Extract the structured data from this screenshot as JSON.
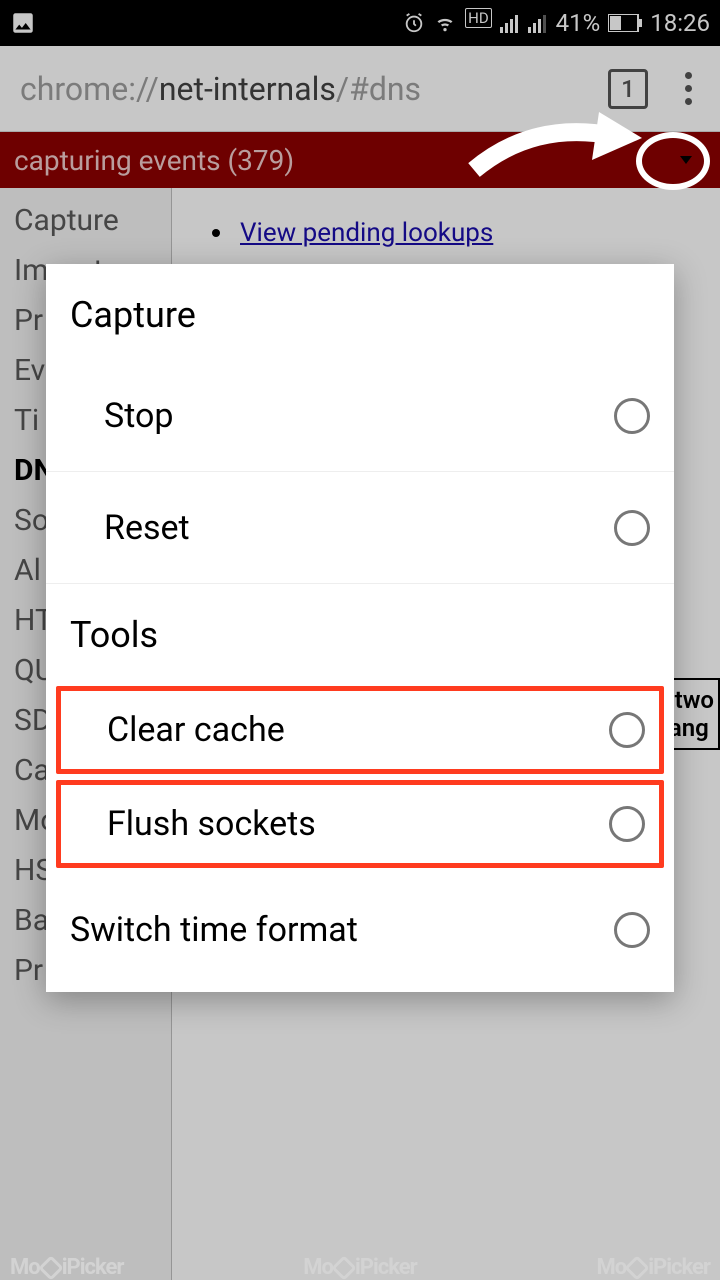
{
  "status": {
    "battery_pct": "41%",
    "time": "18:26",
    "hd": "HD"
  },
  "omnibox": {
    "url_pre": "chrome://",
    "url_bold": "net-internals",
    "url_post": "/#dns",
    "tab_count": "1"
  },
  "banner": {
    "text": "capturing events (379)"
  },
  "sidebar": {
    "items": [
      {
        "label": "Capture"
      },
      {
        "label": "Import"
      },
      {
        "label": "Pr"
      },
      {
        "label": "Ev"
      },
      {
        "label": "Ti"
      },
      {
        "label": "DN",
        "active": true
      },
      {
        "label": "So"
      },
      {
        "label": "Al"
      },
      {
        "label": "HT"
      },
      {
        "label": "QU"
      },
      {
        "label": "SD"
      },
      {
        "label": "Ca"
      },
      {
        "label": "Mo"
      },
      {
        "label": "HS"
      },
      {
        "label": "Ba"
      },
      {
        "label": "Pr"
      }
    ]
  },
  "main": {
    "pending_link": "View pending lookups",
    "peek_line1": "letwo",
    "peek_line2": "hang"
  },
  "dialog": {
    "section_capture": "Capture",
    "opt_stop": "Stop",
    "opt_reset": "Reset",
    "section_tools": "Tools",
    "opt_clear_cache": "Clear cache",
    "opt_flush_sockets": "Flush sockets",
    "opt_switch_time": "Switch time format"
  },
  "watermark": {
    "brand_a": "Mo",
    "brand_b": "iPicker"
  }
}
